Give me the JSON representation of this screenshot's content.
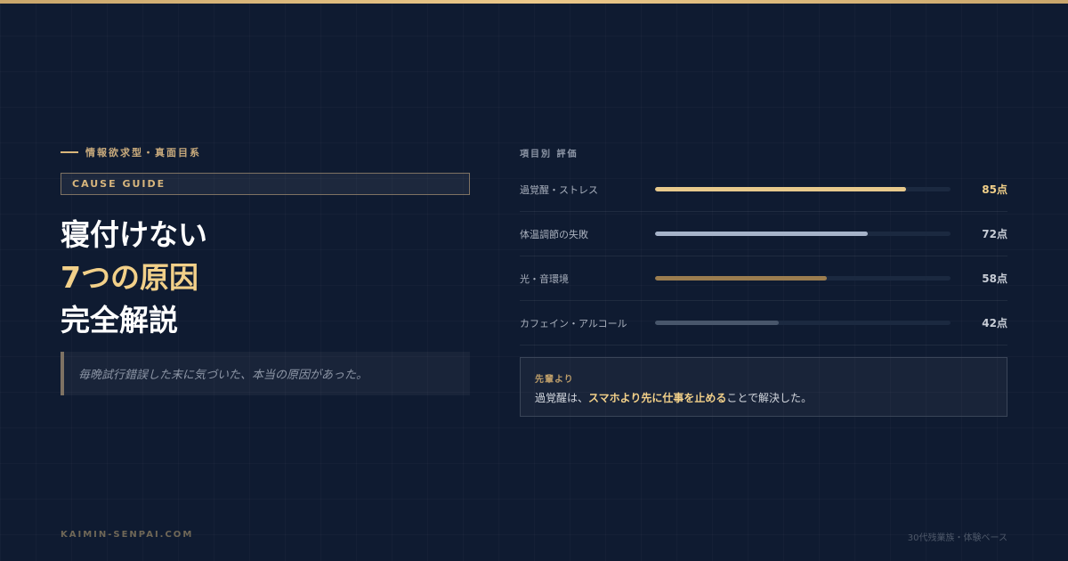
{
  "eyebrow": "情報欲求型・真面目系",
  "badge": "CAUSE GUIDE",
  "headline": {
    "line1": "寝付けない",
    "line2": "7つの原因",
    "line3": "完全解説"
  },
  "quote": "毎晩試行錯誤した末に気づいた、本当の原因があった。",
  "ratings": {
    "title": "項目別 評価",
    "items": [
      {
        "label": "過覚醒・ストレス",
        "score": 85,
        "display": "85点",
        "color": "#e7c98c"
      },
      {
        "label": "体温調節の失敗",
        "score": 72,
        "display": "72点",
        "color": "#a6b3c9"
      },
      {
        "label": "光・音環境",
        "score": 58,
        "display": "58点",
        "color": "#9b7d4f"
      },
      {
        "label": "カフェイン・アルコール",
        "score": 42,
        "display": "42点",
        "color": "#48566b"
      }
    ]
  },
  "note": {
    "title": "先輩より",
    "text_before": "過覚醒は、",
    "text_highlight": "スマホより先に仕事を止める",
    "text_after": "ことで解決した。"
  },
  "footer": {
    "site": "KAIMIN-SENPAI.COM",
    "tag": "30代残業族・体験ベース"
  },
  "colors": {
    "background": "#0f1b31",
    "accent_gold": "#f2d089"
  }
}
